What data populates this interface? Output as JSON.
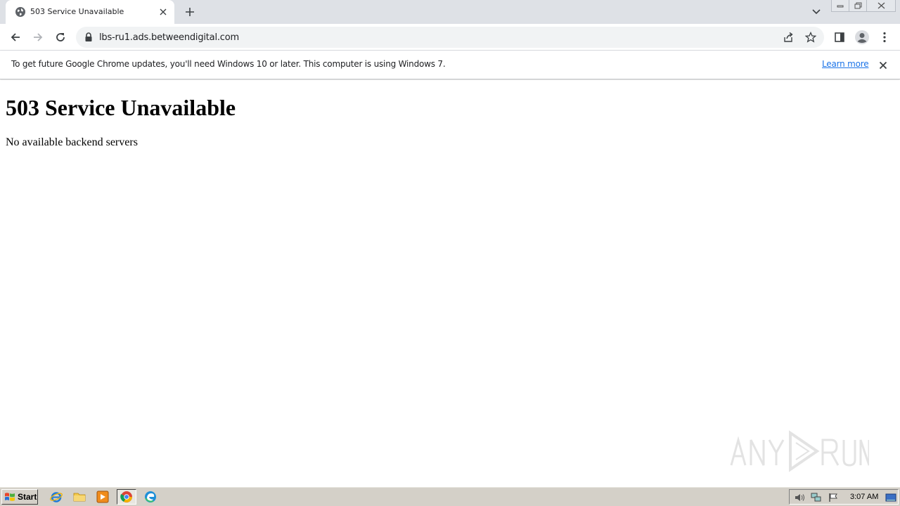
{
  "tab": {
    "title": "503 Service Unavailable",
    "favicon": "globe-icon"
  },
  "toolbar": {
    "url": "lbs-ru1.ads.betweendigital.com",
    "icons": [
      "back-icon",
      "forward-icon",
      "reload-icon",
      "lock-icon",
      "share-icon",
      "bookmark-star-icon",
      "side-panel-icon",
      "profile-icon",
      "menu-icon"
    ]
  },
  "infobar": {
    "message": "To get future Google Chrome updates, you'll need Windows 10 or later. This computer is using Windows 7.",
    "link": "Learn more"
  },
  "page": {
    "heading": "503 Service Unavailable",
    "message": "No available backend servers"
  },
  "taskbar": {
    "start_label": "Start",
    "clock": "3:07 AM",
    "apps": [
      "internet-explorer-icon",
      "file-explorer-icon",
      "media-player-icon",
      "chrome-icon",
      "edge-icon"
    ]
  },
  "colors": {
    "tabstrip": "#dee1e6",
    "omnibox": "#f1f3f4",
    "link": "#1a73e8",
    "taskbar": "#d4d0c8"
  }
}
